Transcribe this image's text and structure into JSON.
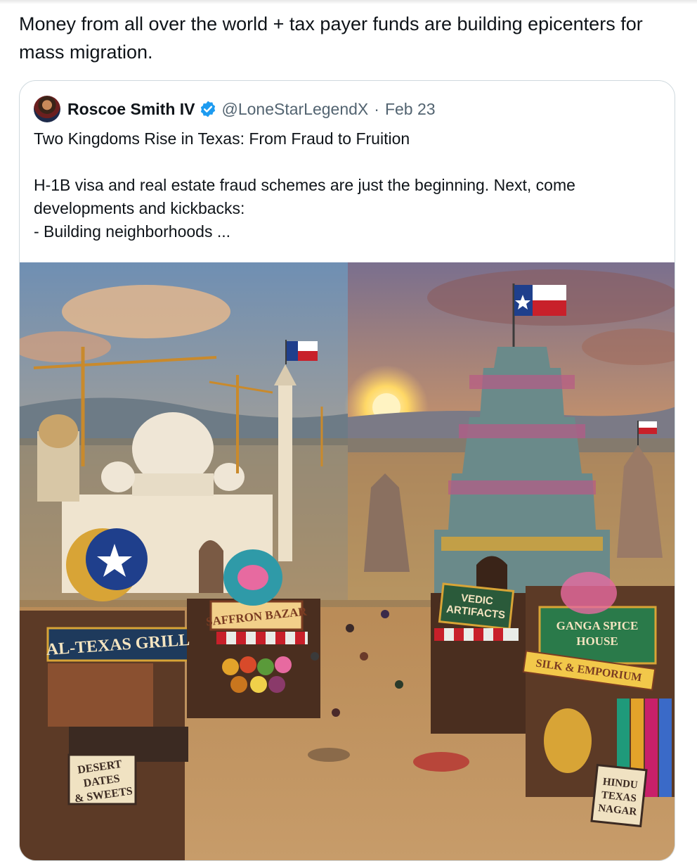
{
  "post": {
    "text": "Money from all over the world + tax payer funds are building epicenters for mass migration."
  },
  "quoted": {
    "author_name": "Roscoe Smith IV",
    "handle": "@LoneStarLegendX",
    "separator": "·",
    "date": "Feb 23",
    "lines": [
      "Two Kingdoms Rise in Texas: From Fraud to Fruition",
      "",
      "H-1B visa and real estate fraud schemes are just the beginning. Next, come developments and kickbacks:",
      "- Building neighborhoods ..."
    ]
  },
  "image": {
    "signs": {
      "grill": "AL-TEXAS GRILL",
      "bazar": "SAFFRON BAZAR",
      "dates_line1": "DESERT",
      "dates_line2": "DATES",
      "dates_line3": "& SWEETS",
      "vedic_line1": "VEDIC",
      "vedic_line2": "ARTIFACTS",
      "ganga_line1": "GANGA SPICE",
      "ganga_line2": "HOUSE",
      "silk": "SILK & EMPORIUM",
      "nagar_line1": "HINDU",
      "nagar_line2": "TEXAS",
      "nagar_line3": "NAGAR"
    }
  },
  "colors": {
    "verified_blue": "#1d9bf0",
    "muted_text": "#536471",
    "card_border": "#cfd9de"
  }
}
